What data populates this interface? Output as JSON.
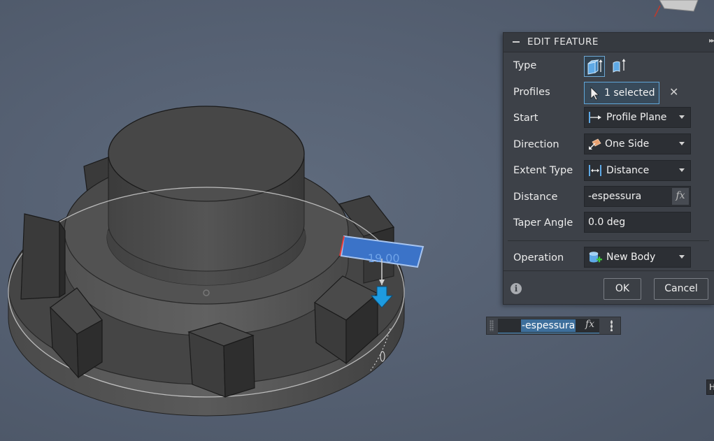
{
  "panel": {
    "title": "EDIT FEATURE",
    "rows": {
      "type": {
        "label": "Type"
      },
      "profiles": {
        "label": "Profiles",
        "value": "1 selected"
      },
      "start": {
        "label": "Start",
        "value": "Profile Plane"
      },
      "direction": {
        "label": "Direction",
        "value": "One Side"
      },
      "extent_type": {
        "label": "Extent Type",
        "value": "Distance"
      },
      "distance": {
        "label": "Distance",
        "value": "-espessura",
        "fx": "fx"
      },
      "taper_angle": {
        "label": "Taper Angle",
        "value": "0.0 deg"
      },
      "operation": {
        "label": "Operation",
        "value": "New Body"
      }
    },
    "buttons": {
      "ok": "OK",
      "cancel": "Cancel"
    }
  },
  "canvas": {
    "dimension_label": "-19.00",
    "floating_input": {
      "value": "-espessura",
      "fx": "fx"
    },
    "edge_tab": "H"
  },
  "colors": {
    "viewport_background": "#566173",
    "panel_background": "#3d4148",
    "selection_blue": "#3b73c8",
    "arrow_blue": "#1e9be0",
    "accent": "#5fa6d9"
  },
  "icons": [
    "extrude-solid-icon",
    "extrude-surface-icon",
    "cursor-arrow-icon",
    "close-icon",
    "profile-plane-icon",
    "one-side-icon",
    "distance-icon",
    "new-body-icon",
    "info-icon",
    "fx-icon",
    "more-icon",
    "grip-icon",
    "view-cube-icon"
  ]
}
